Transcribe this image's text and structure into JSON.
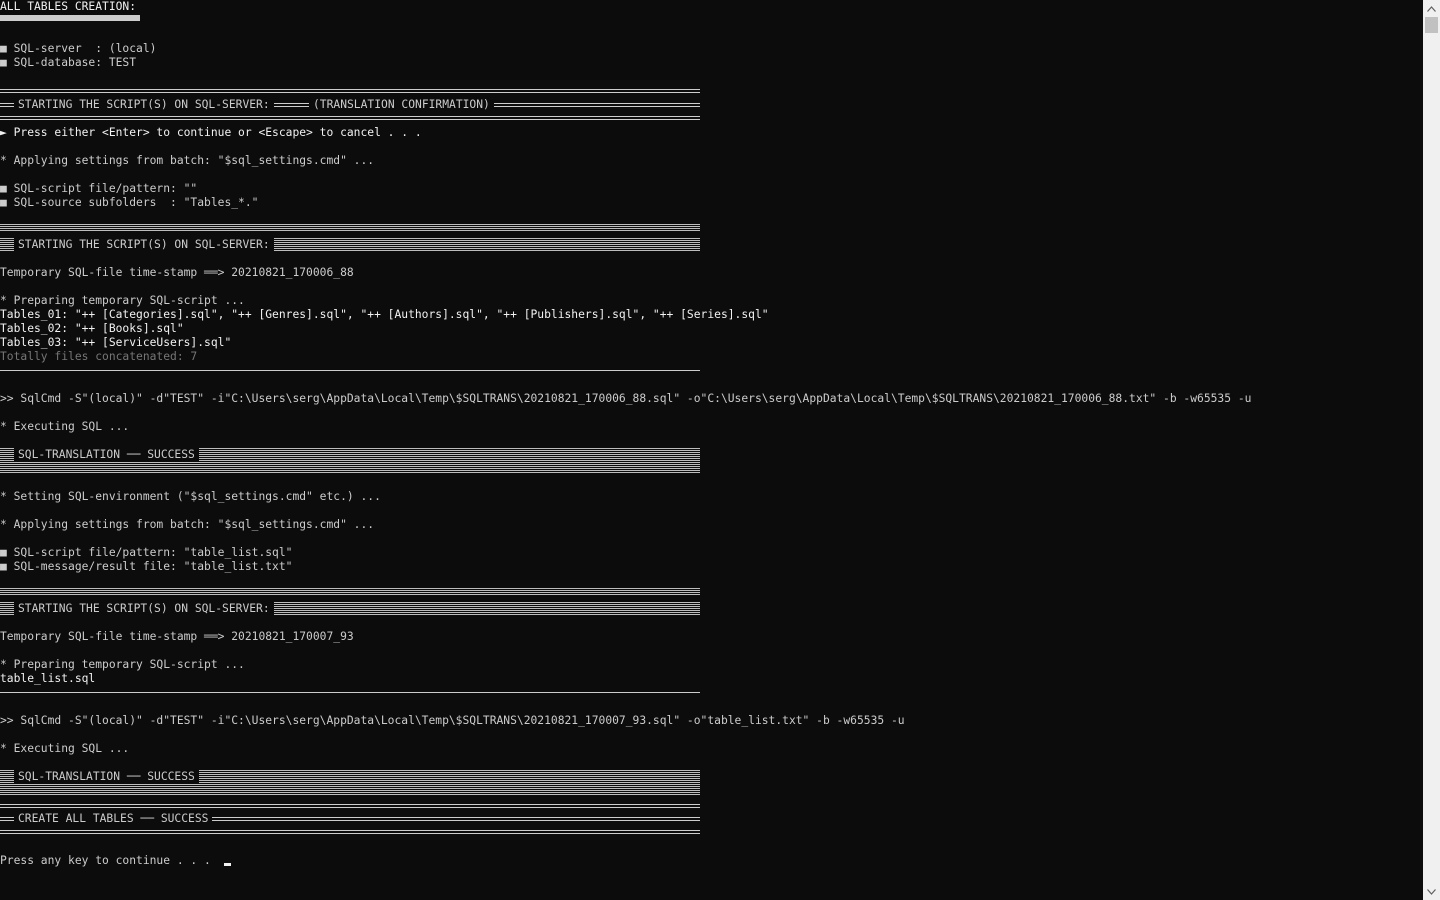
{
  "console": {
    "title": "ALL TABLES CREATION:",
    "server_line": "■ SQL-server  : (local)",
    "database_line": "■ SQL-database: TEST",
    "section1_header": "STARTING THE SCRIPT(S) ON SQL-SERVER:",
    "section1_header_suffix": "(TRANSLATION CONFIRMATION)",
    "press_enter_line": "► Press either <Enter> to continue or <Escape> to cancel . . .",
    "applying_1": "* Applying settings from batch: \"$sql_settings.cmd\" ...",
    "script_pattern_1": "■ SQL-script file/pattern: \"\"",
    "source_subfolders": "■ SQL-source subfolders  : \"Tables_*.\"",
    "section2_header": "STARTING THE SCRIPT(S) ON SQL-SERVER:",
    "timestamp_1": "Temporary SQL-file time-stamp ══> 20210821_170006_88",
    "preparing_1": "* Preparing temporary SQL-script ...",
    "tables_01": "Tables_01: \"++ [Categories].sql\", \"++ [Genres].sql\", \"++ [Authors].sql\", \"++ [Publishers].sql\", \"++ [Series].sql\"",
    "tables_02": "Tables_02: \"++ [Books].sql\"",
    "tables_03": "Tables_03: \"++ [ServiceUsers].sql\"",
    "totally_files": "Totally files concatenated: 7",
    "sqlcmd_1": ">> SqlCmd -S\"(local)\" -d\"TEST\" -i\"C:\\Users\\serg\\AppData\\Local\\Temp\\$SQLTRANS\\20210821_170006_88.sql\" -o\"C:\\Users\\serg\\AppData\\Local\\Temp\\$SQLTRANS\\20210821_170006_88.txt\" -b -w65535 -u",
    "executing_1": "* Executing SQL ...",
    "success_1": "SQL-TRANSLATION ── SUCCESS",
    "setting_env": "* Setting SQL-environment (\"$sql_settings.cmd\" etc.) ...",
    "applying_2": "* Applying settings from batch: \"$sql_settings.cmd\" ...",
    "script_pattern_2": "■ SQL-script file/pattern: \"table_list.sql\"",
    "message_file": "■ SQL-message/result file: \"table_list.txt\"",
    "section3_header": "STARTING THE SCRIPT(S) ON SQL-SERVER:",
    "timestamp_2": "Temporary SQL-file time-stamp ══> 20210821_170007_93",
    "preparing_2": "* Preparing temporary SQL-script ...",
    "table_list_sql": "table_list.sql",
    "sqlcmd_2": ">> SqlCmd -S\"(local)\" -d\"TEST\" -i\"C:\\Users\\serg\\AppData\\Local\\Temp\\$SQLTRANS\\20210821_170007_93.sql\" -o\"table_list.txt\" -b -w65535 -u",
    "executing_2": "* Executing SQL ...",
    "success_2": "SQL-TRANSLATION ── SUCCESS",
    "create_all_success": "CREATE ALL TABLES ── SUCCESS",
    "press_any_key": "Press any key to continue . . ."
  },
  "scrollbar": {
    "up_icon": "scroll-up-arrow-icon",
    "down_icon": "scroll-down-arrow-icon"
  },
  "colors": {
    "background": "#0c0c0c",
    "text": "#cccccc",
    "bright_text": "#f2f2f2",
    "dim_text": "#767676"
  }
}
